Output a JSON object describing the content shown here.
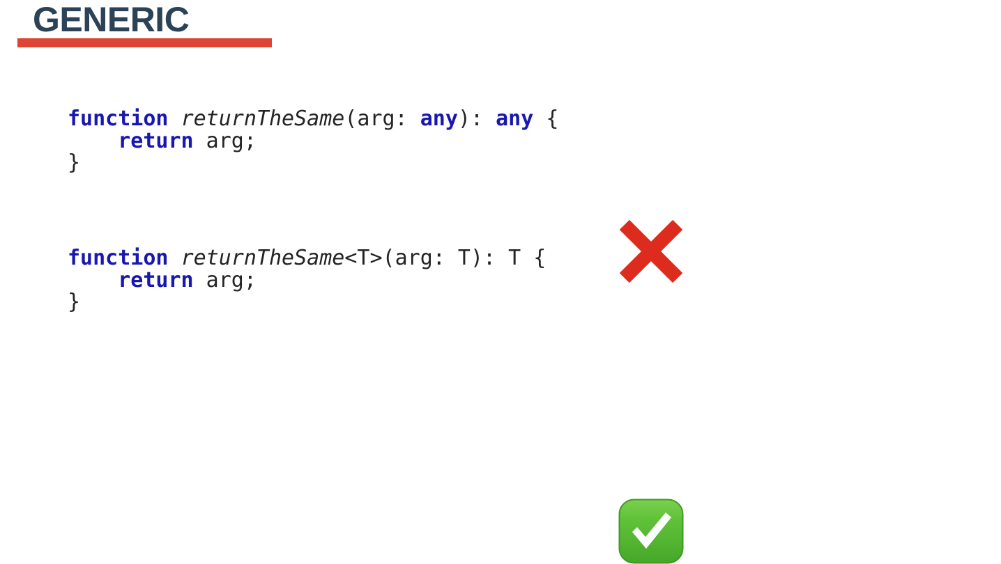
{
  "slide": {
    "title": "GENERIC",
    "title_color": "#2b4257",
    "underline_color": "#dd4433",
    "background_color": "#ffffff"
  },
  "code_examples": [
    {
      "id": "bad-example",
      "verdict": "incorrect",
      "verdict_icon": "cross-mark-icon",
      "verdict_color": "#dd2b1e",
      "lines": [
        [
          {
            "text": "function",
            "style": "kw"
          },
          {
            "text": " ",
            "style": "plain"
          },
          {
            "text": "returnTheSame",
            "style": "fn"
          },
          {
            "text": "(arg: ",
            "style": "plain"
          },
          {
            "text": "any",
            "style": "kw"
          },
          {
            "text": "): ",
            "style": "plain"
          },
          {
            "text": "any",
            "style": "kw"
          },
          {
            "text": " {",
            "style": "plain"
          }
        ],
        [
          {
            "text": "    ",
            "style": "plain"
          },
          {
            "text": "return",
            "style": "kw"
          },
          {
            "text": " arg;",
            "style": "plain"
          }
        ],
        [
          {
            "text": "}",
            "style": "plain"
          }
        ]
      ]
    },
    {
      "id": "good-example",
      "verdict": "correct",
      "verdict_icon": "check-mark-icon",
      "verdict_color": "#5cb531",
      "lines": [
        [
          {
            "text": "function",
            "style": "kw"
          },
          {
            "text": " ",
            "style": "plain"
          },
          {
            "text": "returnTheSame",
            "style": "fn"
          },
          {
            "text": "<T>(arg: T): T {",
            "style": "plain"
          }
        ],
        [
          {
            "text": "    ",
            "style": "plain"
          },
          {
            "text": "return",
            "style": "kw"
          },
          {
            "text": " arg;",
            "style": "plain"
          }
        ],
        [
          {
            "text": "}",
            "style": "plain"
          }
        ]
      ]
    }
  ]
}
